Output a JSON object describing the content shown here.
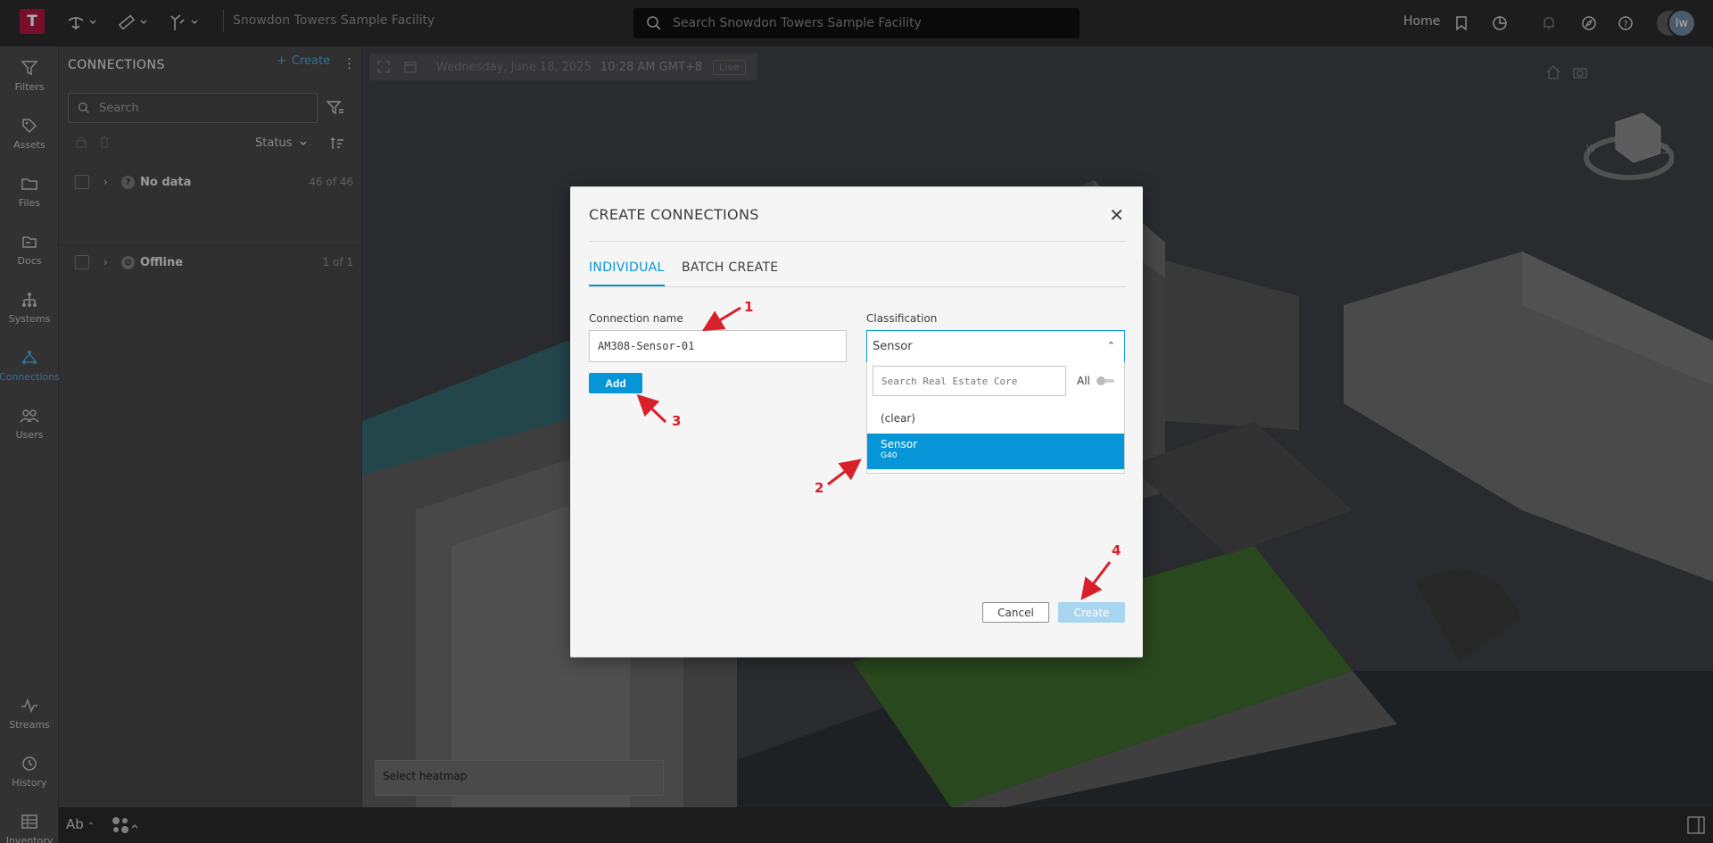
{
  "app": {
    "logo_letter": "T",
    "facility_title": "Snowdon Towers Sample Facility",
    "search_placeholder": "Search Snowdon Towers Sample Facility",
    "home_label": "Home",
    "avatar_initials": "lw",
    "accent_color": "#0696d7",
    "brand_color": "#b0153f"
  },
  "leftnav": {
    "items": [
      {
        "label": "Filters",
        "icon": "filter-icon"
      },
      {
        "label": "Assets",
        "icon": "tag-icon"
      },
      {
        "label": "Files",
        "icon": "folder-icon"
      },
      {
        "label": "Docs",
        "icon": "docs-icon"
      },
      {
        "label": "Systems",
        "icon": "hierarchy-icon"
      },
      {
        "label": "Connections",
        "icon": "connections-icon",
        "active": true
      },
      {
        "label": "Users",
        "icon": "users-icon"
      },
      {
        "label": "Streams",
        "icon": "pulse-icon"
      },
      {
        "label": "History",
        "icon": "history-icon"
      },
      {
        "label": "Inventory",
        "icon": "table-icon"
      }
    ]
  },
  "panel": {
    "title": "CONNECTIONS",
    "create_label": "Create",
    "search_placeholder": "Search",
    "status_label": "Status",
    "rows": [
      {
        "label": "No data",
        "count": "46 of 46",
        "icon": "question-icon"
      },
      {
        "label": "Offline",
        "count": "1 of 1",
        "icon": "offline-icon"
      }
    ]
  },
  "viewport": {
    "date": "Wednesday, June 18, 2025",
    "time": "10:28 AM GMT+8",
    "live": "Live",
    "heatmap_label": "Select heatmap"
  },
  "bottombar": {
    "text_tool": "Ab"
  },
  "modal": {
    "title": "CREATE CONNECTIONS",
    "tabs": [
      "INDIVIDUAL",
      "BATCH CREATE"
    ],
    "active_tab": "INDIVIDUAL",
    "connection_name_label": "Connection name",
    "connection_name_value": "AM308-Sensor-01",
    "add_label": "Add",
    "classification_label": "Classification",
    "classification_value": "Sensor",
    "dropdown": {
      "search_placeholder": "Search Real Estate Core",
      "all_label": "All",
      "options": [
        {
          "label": "(clear)"
        },
        {
          "label": "Sensor",
          "sub": "G40",
          "selected": true
        }
      ]
    },
    "cancel_label": "Cancel",
    "create_label": "Create"
  },
  "annotations": [
    "1",
    "2",
    "3",
    "4"
  ]
}
